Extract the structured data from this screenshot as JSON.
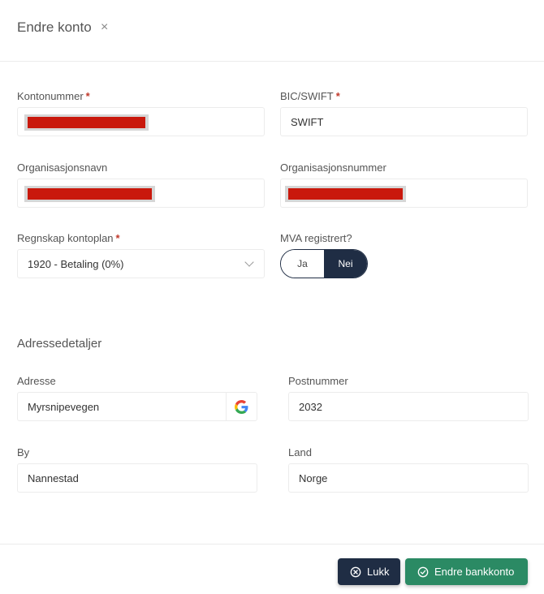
{
  "modal": {
    "title": "Endre konto",
    "close_glyph": "×"
  },
  "fields": {
    "account_number": {
      "label": "Kontonummer",
      "required": "*"
    },
    "bic": {
      "label": "BIC/SWIFT",
      "required": "*",
      "value": "SWIFT"
    },
    "org_name": {
      "label": "Organisasjonsnavn"
    },
    "org_number": {
      "label": "Organisasjonsnummer"
    },
    "accounting_plan": {
      "label": "Regnskap kontoplan",
      "required": "*",
      "value": "1920 - Betaling (0%)"
    },
    "vat": {
      "label": "MVA registrert?",
      "options": [
        "Ja",
        "Nei"
      ],
      "selected": "Nei"
    }
  },
  "address": {
    "section_title": "Adressedetaljer",
    "address": {
      "label": "Adresse",
      "value": "Myrsnipevegen"
    },
    "postal_code": {
      "label": "Postnummer",
      "value": "2032"
    },
    "city": {
      "label": "By",
      "value": "Nannestad"
    },
    "country": {
      "label": "Land",
      "value": "Norge"
    }
  },
  "footer": {
    "close_label": "Lukk",
    "save_label": "Endre bankkonto"
  },
  "colors": {
    "navy": "#1f2d44",
    "green": "#2b8a64",
    "required_red": "#c0392b",
    "redaction": "#c9180c"
  },
  "icons": [
    "close-icon",
    "chevron-down-icon",
    "google-icon",
    "circle-x-icon",
    "circle-check-icon"
  ]
}
